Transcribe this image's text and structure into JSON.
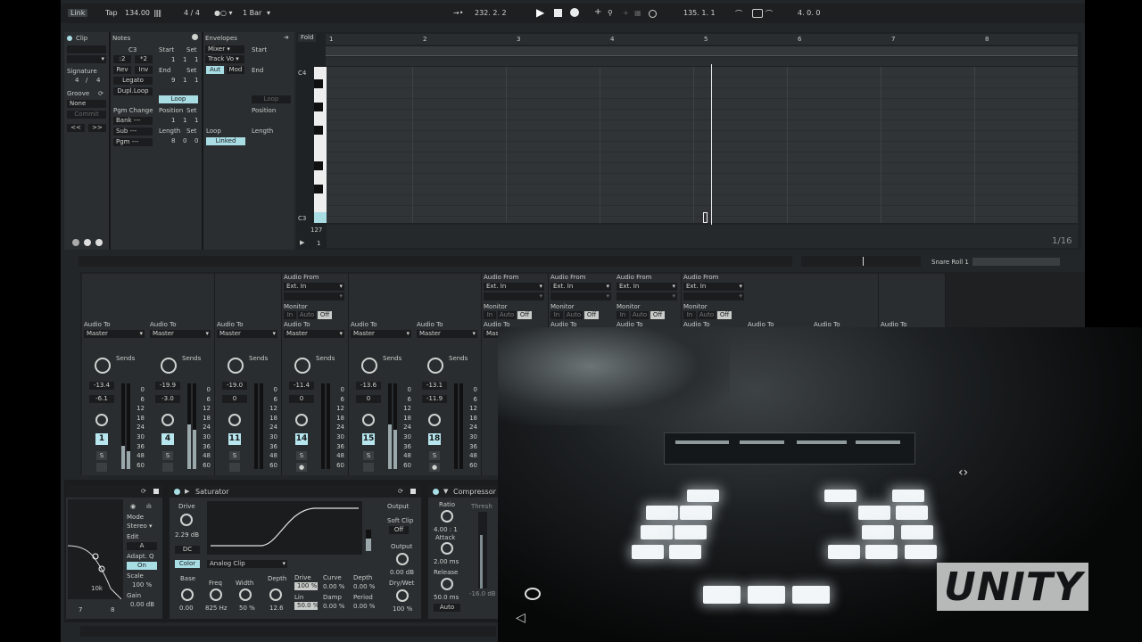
{
  "transport": {
    "link": "Link",
    "tap": "Tap",
    "tempo": "134.00",
    "signature": "4 / 4",
    "quantize": "1 Bar",
    "position": "232.  2.  2",
    "loop_start": "135.  1.  1",
    "loop_length": "4.  0.  0"
  },
  "clip": {
    "title": "Clip",
    "signature_label": "Signature",
    "sig_num": "4",
    "sig_slash": "/",
    "sig_den": "4",
    "groove_label": "Groove",
    "groove_value": "None",
    "commit": "Commit"
  },
  "notes": {
    "title": "Notes",
    "note": "C3",
    "half": ":2",
    "double": "*2",
    "rev": "Rev",
    "inv": "Inv",
    "legato": "Legato",
    "dupl_loop": "Dupl.Loop",
    "pgm_change": "Pgm Change",
    "bank": "Bank ---",
    "sub": "Sub ---",
    "pgm": "Pgm ---",
    "start_label": "Start",
    "set": "Set",
    "start": [
      "1",
      "1",
      "1"
    ],
    "end_label": "End",
    "end": [
      "9",
      "1",
      "1"
    ],
    "loop": "Loop",
    "position_label": "Position",
    "position": [
      "1",
      "1",
      "1"
    ],
    "length_label": "Length",
    "length": [
      "8",
      "0",
      "0"
    ]
  },
  "envelopes": {
    "title": "Envelopes",
    "mixer": "Mixer",
    "track_vol": "Track Vo",
    "aut": "Aut",
    "mod": "Mod",
    "start_label": "Start",
    "end_label": "End",
    "loop_btn": "Loop",
    "position_label": "Position",
    "loop_label": "Loop",
    "linked": "Linked",
    "length_label": "Length"
  },
  "editor": {
    "fold": "Fold",
    "bars": [
      "1",
      "2",
      "3",
      "4",
      "5",
      "6",
      "7",
      "8"
    ],
    "c4": "C4",
    "c3": "C3",
    "velocity_max": "127",
    "velocity_min": "1",
    "grid": "1/16"
  },
  "device_title": "Snare Roll 1",
  "io": {
    "audio_from": "Audio From",
    "ext_in": "Ext. In",
    "monitor": "Monitor",
    "in": "In",
    "auto": "Auto",
    "off": "Off",
    "audio_to": "Audio To",
    "master": "Master",
    "sends": "Sends"
  },
  "db_scale": [
    "0",
    "6",
    "12",
    "18",
    "24",
    "30",
    "36",
    "48",
    "60"
  ],
  "tracks": [
    {
      "num": "1",
      "vol": "-13.4",
      "pan": "-6.1"
    },
    {
      "num": "4",
      "vol": "-19.9",
      "pan": "-3.0"
    },
    {
      "num": "11",
      "vol": "-19.0",
      "pan": "0"
    },
    {
      "num": "14",
      "vol": "-11.4",
      "pan": "0"
    },
    {
      "num": "15",
      "vol": "-13.6",
      "pan": "0"
    },
    {
      "num": "18",
      "vol": "-13.1",
      "pan": "-11.9"
    }
  ],
  "solo": "S",
  "eq": {
    "mode_label": "Mode",
    "mode": "Stereo",
    "edit": "Edit",
    "edit_a": "A",
    "adapt_q": "Adapt. Q",
    "on": "On",
    "scale_label": "Scale",
    "scale": "100 %",
    "gain_label": "Gain",
    "gain": "0.00 dB",
    "freq_mark": "10k",
    "bands_a": "7",
    "bands_b": "8"
  },
  "saturator": {
    "title": "Saturator",
    "drive_label": "Drive",
    "drive": "2.29 dB",
    "dc": "DC",
    "color": "Color",
    "type": "Analog Clip",
    "output_label": "Output",
    "soft_clip": "Soft Clip",
    "soft_clip_value": "Off",
    "output2_label": "Output",
    "output": "0.00 dB",
    "drywet_label": "Dry/Wet",
    "drywet": "100 %",
    "base_label": "Base",
    "base": "0.00",
    "freq_label": "Freq",
    "freq": "825 Hz",
    "width_label": "Width",
    "width": "50 %",
    "depth_label": "Depth",
    "depth": "12.6",
    "ws_drive_label": "Drive",
    "ws_drive": "100 %",
    "ws_curve_label": "Curve",
    "ws_curve": "0.00 %",
    "ws_depth_label": "Depth",
    "ws_depth": "0.00 %",
    "ws_lin_label": "Lin",
    "ws_lin": "50.0 %",
    "ws_damp_label": "Damp",
    "ws_damp": "0.00 %",
    "ws_period_label": "Period",
    "ws_period": "0.00 %"
  },
  "compressor": {
    "title": "Compressor",
    "ratio_label": "Ratio",
    "ratio": "4.00 : 1",
    "attack_label": "Attack",
    "attack": "2.00 ms",
    "release_label": "Release",
    "release": "50.0 ms",
    "auto": "Auto",
    "thresh_label": "Thresh",
    "thresh": "-16.0 dB"
  },
  "logo": "UNITY"
}
